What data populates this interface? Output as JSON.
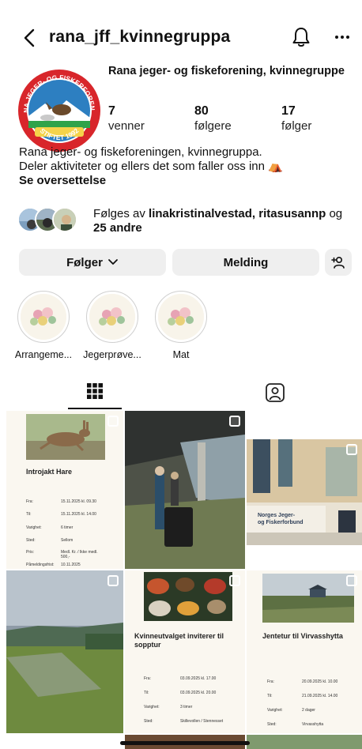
{
  "header": {
    "username": "rana_jff_kvinnegruppa"
  },
  "profile": {
    "full_name": "Rana jeger- og fiskeforening, kvinnegruppe",
    "logo_text_top": "RANA JEGER- OG FISKERFORENING",
    "logo_text_bottom": "STIFTET 1992",
    "stats": [
      {
        "value": "7",
        "label": "venner"
      },
      {
        "value": "80",
        "label": "følgere"
      },
      {
        "value": "17",
        "label": "følger"
      }
    ],
    "bio_line1": "Rana jeger- og fiskeforeningen, kvinnegruppa.",
    "bio_line2": "Deler aktiviteter og ellers det som faller oss inn ⛺",
    "see_translation": "Se oversettelse",
    "followed_by_prefix": "Følges av ",
    "followed_by_names": "linakristinalvestad, ritasusannp",
    "followed_by_mid": " og",
    "followed_by_others": "25 andre"
  },
  "actions": {
    "following_label": "Følger",
    "message_label": "Melding"
  },
  "highlights": [
    {
      "label": "Arrangeme..."
    },
    {
      "label": "Jegerprøve..."
    },
    {
      "label": "Mat"
    }
  ],
  "posts": {
    "post1": {
      "title": "Introjakt Hare",
      "rows": [
        {
          "k": "Fra:",
          "v": "15.11.2025 kl. 09.30"
        },
        {
          "k": "Til:",
          "v": "15.11.2025 kl. 14.00"
        },
        {
          "k": "Varighet:",
          "v": "6 timer"
        },
        {
          "k": "Sted:",
          "v": "Sellom"
        },
        {
          "k": "Pris:",
          "v": "Medl. Kr. / Ikke medl. 500,-"
        },
        {
          "k": "Påmeldingsfrist:",
          "v": "10.11.2025"
        }
      ]
    },
    "post3": {
      "banner1": "Norges Jeger-",
      "banner2": "og Fiskerforbund"
    },
    "post5": {
      "title": "Kvinneutvalget inviterer til sopptur",
      "rows": [
        {
          "k": "Fra:",
          "v": "03.09.2025 kl. 17.00"
        },
        {
          "k": "Til:",
          "v": "03.09.2025 kl. 20.00"
        },
        {
          "k": "Varighet:",
          "v": "3 timer"
        },
        {
          "k": "Sted:",
          "v": "Skillevollen / Stennesset"
        }
      ]
    },
    "post6": {
      "title": "Jentetur til Virvasshytta",
      "rows": [
        {
          "k": "Fra:",
          "v": "20.09.2025 kl. 10.00"
        },
        {
          "k": "Til:",
          "v": "21.09.2025 kl. 14.00"
        },
        {
          "k": "Varighet:",
          "v": "2 dager"
        },
        {
          "k": "Sted:",
          "v": "Virvasshytta"
        }
      ]
    }
  }
}
